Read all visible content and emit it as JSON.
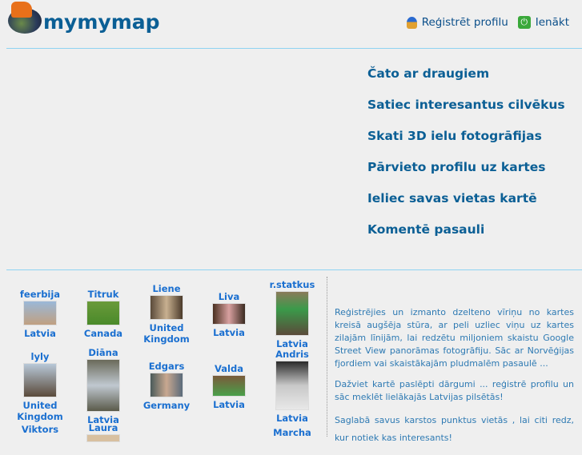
{
  "header": {
    "logo_text": "mymymap",
    "register_label": "Reģistrēt profilu",
    "login_label": "Ienākt"
  },
  "features": [
    "Čato ar draugiem",
    "Satiec interesantus cilvēkus",
    "Skati 3D ielu fotogrāfijas",
    "Pārvieto profilu uz kartes",
    "Ieliec savas vietas kartē",
    "Komentē pasauli"
  ],
  "profiles": [
    {
      "name": "feerbija",
      "country": "Latvia"
    },
    {
      "name": "Titruk",
      "country": "Canada"
    },
    {
      "name": "Liene",
      "country": "United Kingdom"
    },
    {
      "name": "Liva",
      "country": "Latvia"
    },
    {
      "name": "r.statkus",
      "country": "Latvia"
    },
    {
      "name": "lyly",
      "country": "United Kingdom"
    },
    {
      "name": "Diāna",
      "country": "Latvia"
    },
    {
      "name": "Edgars",
      "country": "Germany"
    },
    {
      "name": "Valda",
      "country": "Latvia"
    },
    {
      "name": "Andris",
      "country": "Latvia"
    },
    {
      "name": "Viktors"
    },
    {
      "name": "Laura"
    },
    {
      "name": "Marcha"
    }
  ],
  "description": [
    "Reģistrējies un izmanto dzelteno vīriņu        no kartes kreisā augšēja stūra, ar peli uzliec viņu uz kartes zilajām līnijām, lai redzētu miljoniem skaistu Google Street View panorāmas fotogrāfiju. Sāc ar Norvēģijas fjordiem vai skaistākajām pludmalēm pasaulē ...",
    "Dažviet kartē paslēpti dārgumi ... reģistrē profilu un sāc meklēt lielākajās Latvijas pilsētās!",
    "Saglabā savus karstos punktus vietās    , lai citi redz, kur notiek kas interesants!"
  ]
}
